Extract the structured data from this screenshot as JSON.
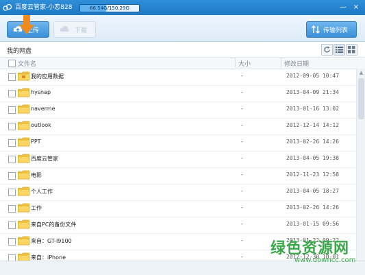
{
  "titlebar": {
    "title": "百度云管家-小恋828",
    "quota_text": "66.54G/150.29G",
    "quota_fraction": 0.44,
    "minimize_glyph": "—",
    "close_glyph": "×"
  },
  "toolbar": {
    "upload_label": "上传",
    "download_label": "下载",
    "transfer_label": "传输列表"
  },
  "path": {
    "current": "我的网盘"
  },
  "columns": {
    "name": "文件名",
    "size": "大小",
    "date": "修改日期"
  },
  "files": [
    {
      "name": "我的应用数据",
      "size": "-",
      "date": "2012-09-05 10:47",
      "icon": "app-folder-icon"
    },
    {
      "name": "hysnap",
      "size": "-",
      "date": "2013-04-09 21:34",
      "icon": "folder-icon"
    },
    {
      "name": "naverme",
      "size": "-",
      "date": "2013-01-16 13:02",
      "icon": "folder-icon"
    },
    {
      "name": "outlook",
      "size": "-",
      "date": "2012-12-14 14:12",
      "icon": "folder-icon"
    },
    {
      "name": "PPT",
      "size": "-",
      "date": "2013-02-26 14:26",
      "icon": "folder-icon"
    },
    {
      "name": "百度云管家",
      "size": "-",
      "date": "2013-04-05 19:38",
      "icon": "folder-icon"
    },
    {
      "name": "电影",
      "size": "-",
      "date": "2012-11-23 12:58",
      "icon": "folder-icon"
    },
    {
      "name": "个人工作",
      "size": "-",
      "date": "2013-04-05 18:27",
      "icon": "folder-icon"
    },
    {
      "name": "工作",
      "size": "-",
      "date": "2013-02-26 14:26",
      "icon": "folder-icon"
    },
    {
      "name": "来自PC的备份文件",
      "size": "-",
      "date": "2013-01-15 09:56",
      "icon": "folder-icon"
    },
    {
      "name": "来自：GT-I9100",
      "size": "-",
      "date": "2013-01-22 09:22",
      "icon": "folder-icon"
    },
    {
      "name": "来自：iPhone",
      "size": "-",
      "date": "2012-12-30 10:01",
      "icon": "folder-icon"
    }
  ],
  "watermark": {
    "title": "绿色资源网",
    "url": "www.downcc.com"
  },
  "colors": {
    "accent": "#2f8fd8",
    "folder": "#f6c84a",
    "watermark": "#3aa84a",
    "arrow": "#f08a1c"
  }
}
